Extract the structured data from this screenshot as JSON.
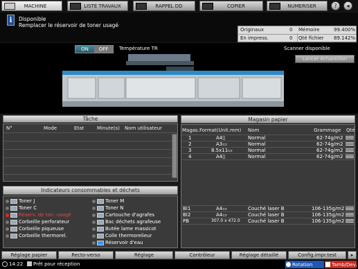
{
  "tabs": [
    {
      "label": "MACHINE"
    },
    {
      "label": "LISTE TRAVAUX"
    },
    {
      "label": "RAPPEL DD"
    },
    {
      "label": "COPIER"
    },
    {
      "label": "NUMERISER"
    }
  ],
  "message": {
    "title": "Disponible",
    "detail": "Remplacer le réservoir de toner usagé"
  },
  "counters": {
    "originaux_label": "Originaux",
    "originaux_value": "0",
    "memoire_label": "Mémoire",
    "memoire_value": "99.400%",
    "impress_label": "En impress.",
    "impress_value": "0",
    "qte_label": "Qté fichier",
    "qte_value": "89.142%"
  },
  "toggle": {
    "on": "ON",
    "off": "OFF",
    "label": "Température TR"
  },
  "scanner": {
    "status": "Scanner disponible",
    "button": "Lancer échantillon"
  },
  "task_panel": {
    "title": "Tâche",
    "headers": [
      "N°",
      "Mode",
      "Etat",
      "Minute(s)",
      "Nom utilisateur"
    ]
  },
  "consumables_panel": {
    "title": "Indicateurs consommables et déchets",
    "left": [
      {
        "label": "Toner J",
        "alert": false
      },
      {
        "label": "Toner C",
        "alert": false
      },
      {
        "label": "Réserv. de ton. usagé",
        "alert": true
      },
      {
        "label": "Corbeille perforateur",
        "alert": false
      },
      {
        "label": "Corbeille piqueuse",
        "alert": false
      },
      {
        "label": "Corbeille thermorel.",
        "alert": false
      }
    ],
    "right": [
      {
        "label": "Toner M"
      },
      {
        "label": "Toner N"
      },
      {
        "label": "Cartouche d'agrafes"
      },
      {
        "label": "Bac déchets agrafeuse"
      },
      {
        "label": "Butée lame massicot"
      },
      {
        "label": "Colle thermorelieur"
      },
      {
        "label": "Réservoir d'eau"
      }
    ]
  },
  "paper_panel": {
    "title": "Magasin papier",
    "headers": [
      "Magas.",
      "Format(Unit.mm)",
      "Nom",
      "Grammage",
      "Qté"
    ],
    "rows": [
      {
        "tray": "1",
        "format": "A4▯",
        "name": "Normal",
        "weight": "62-74g/m2"
      },
      {
        "tray": "2",
        "format": "A3▭",
        "name": "Normal",
        "weight": "62-74g/m2"
      },
      {
        "tray": "3",
        "format": "8.5x11▭",
        "name": "Normal",
        "weight": "62-74g/m2"
      },
      {
        "tray": "4",
        "format": "A4▯",
        "name": "Normal",
        "weight": "62-74g/m2"
      }
    ],
    "rows2": [
      {
        "tray": "BI1",
        "format": "A4▭",
        "name": "Couché laser B",
        "weight": "106-135g/m2"
      },
      {
        "tray": "BI2",
        "format": "A4▭",
        "name": "Couché laser B",
        "weight": "106-135g/m2"
      },
      {
        "tray": "PB",
        "format": "307.0 x 472.0",
        "name": "Couché laser B",
        "weight": "106-135g/m2"
      }
    ]
  },
  "bottom_buttons": [
    "Réglage papier",
    "Recto-verso",
    "Réglage",
    "Contrôleur",
    "Réglage détaillé",
    "Config.impr.test"
  ],
  "status": {
    "time": "14:22",
    "text": "Prêt pour réception",
    "rotation": "Rotation",
    "tamb": "Tamb/Dev."
  },
  "colors": {
    "accent_blue": "#1d4f9a",
    "alert_red": "#e22222",
    "panel_bg": "#3a3a3a"
  }
}
